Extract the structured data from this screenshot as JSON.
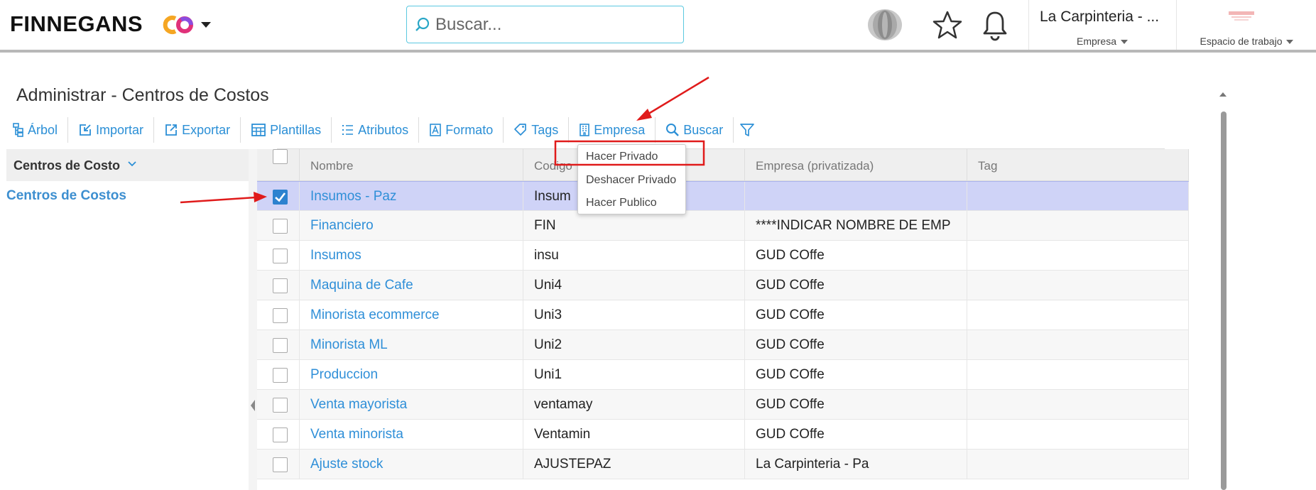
{
  "header": {
    "logo_text": "FINNEGANS",
    "logo_co": "CO",
    "search_placeholder": "Buscar...",
    "company_name": "La Carpinteria - ...",
    "company_label": "Empresa",
    "workspace_label": "Espacio de trabajo"
  },
  "page": {
    "title": "Administrar - Centros de Costos"
  },
  "toolbar": {
    "items": [
      {
        "label": "Árbol",
        "icon": "tree-icon"
      },
      {
        "label": "Importar",
        "icon": "import-icon"
      },
      {
        "label": "Exportar",
        "icon": "export-icon"
      },
      {
        "label": "Plantillas",
        "icon": "template-icon"
      },
      {
        "label": "Atributos",
        "icon": "list-icon"
      },
      {
        "label": "Formato",
        "icon": "format-icon"
      },
      {
        "label": "Tags",
        "icon": "tag-icon"
      },
      {
        "label": "Empresa",
        "icon": "building-icon"
      },
      {
        "label": "Buscar",
        "icon": "search-icon"
      }
    ],
    "filter_icon": "filter-icon"
  },
  "tree": {
    "header": "Centros de Costo",
    "item": "Centros de Costos"
  },
  "grid": {
    "columns": [
      "Nombre",
      "Codigo",
      "Empresa (privatizada)",
      "Tag"
    ],
    "rows": [
      {
        "nombre": "Insumos - Paz",
        "codigo": "Insum",
        "empresa": "",
        "checked": true
      },
      {
        "nombre": "Financiero",
        "codigo": "FIN",
        "empresa": "****INDICAR NOMBRE DE EMP",
        "checked": false
      },
      {
        "nombre": "Insumos",
        "codigo": "insu",
        "empresa": "GUD COffe",
        "checked": false
      },
      {
        "nombre": "Maquina de Cafe",
        "codigo": "Uni4",
        "empresa": "GUD COffe",
        "checked": false
      },
      {
        "nombre": "Minorista ecommerce",
        "codigo": "Uni3",
        "empresa": "GUD COffe",
        "checked": false
      },
      {
        "nombre": "Minorista ML",
        "codigo": "Uni2",
        "empresa": "GUD COffe",
        "checked": false
      },
      {
        "nombre": "Produccion",
        "codigo": "Uni1",
        "empresa": "GUD COffe",
        "checked": false
      },
      {
        "nombre": "Venta mayorista",
        "codigo": "ventamay",
        "empresa": "GUD COffe",
        "checked": false
      },
      {
        "nombre": "Venta minorista",
        "codigo": "Ventamin",
        "empresa": "GUD COffe",
        "checked": false
      },
      {
        "nombre": "Ajuste stock",
        "codigo": "AJUSTEPAZ",
        "empresa": "La Carpinteria - Pa",
        "checked": false
      }
    ]
  },
  "dropdown": {
    "items": [
      "Hacer Privado",
      "Deshacer Privado",
      "Hacer Publico"
    ]
  },
  "colors": {
    "accent": "#2f8fd8",
    "selected_row": "#cfd3f7",
    "annotation": "#e01b1b"
  }
}
